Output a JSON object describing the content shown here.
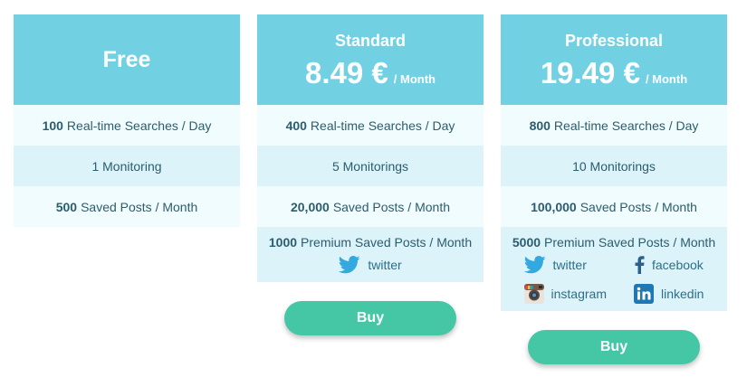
{
  "plans": [
    {
      "name": "Free",
      "features": [
        {
          "num": "100",
          "text": "Real-time Searches / Day"
        },
        {
          "num": "",
          "text": "1 Monitoring"
        },
        {
          "num": "500",
          "text": "Saved Posts / Month"
        }
      ]
    },
    {
      "name": "Standard",
      "price": "8.49 €",
      "period": "/ Month",
      "features": [
        {
          "num": "400",
          "text": "Real-time Searches / Day"
        },
        {
          "num": "",
          "text": "5 Monitorings"
        },
        {
          "num": "20,000",
          "text": "Saved Posts / Month"
        },
        {
          "num": "1000",
          "text": "Premium Saved Posts / Month"
        }
      ],
      "networks": [
        "twitter"
      ],
      "buy_label": "Buy"
    },
    {
      "name": "Professional",
      "price": "19.49 €",
      "period": "/ Month",
      "features": [
        {
          "num": "800",
          "text": "Real-time Searches / Day"
        },
        {
          "num": "",
          "text": "10 Monitorings"
        },
        {
          "num": "100,000",
          "text": "Saved Posts / Month"
        },
        {
          "num": "5000",
          "text": "Premium Saved Posts / Month"
        }
      ],
      "networks": [
        "twitter",
        "facebook",
        "instagram",
        "linkedin"
      ],
      "buy_label": "Buy"
    }
  ],
  "colors": {
    "header": "#72d0e3",
    "row_light": "#f0fcfd",
    "row_dark": "#dbf3f9",
    "buy_button": "#45c7a6",
    "text": "#2c5d6e"
  }
}
